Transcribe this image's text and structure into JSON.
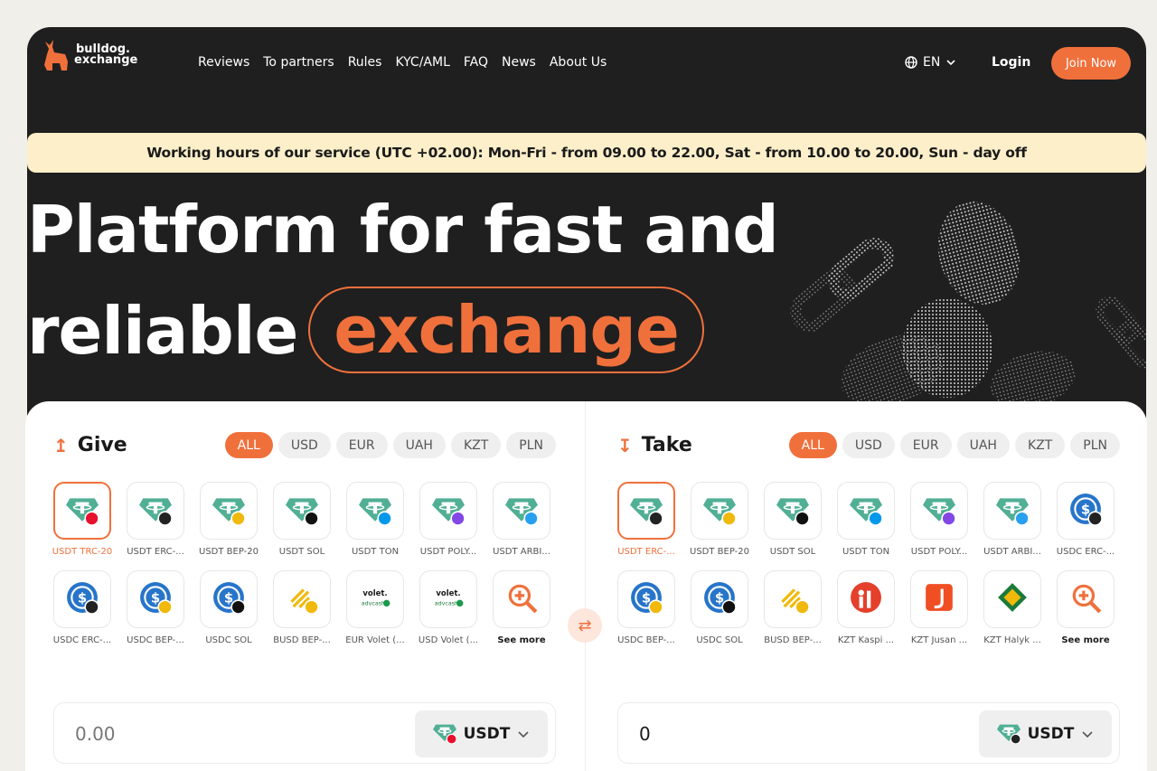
{
  "header": {
    "logo_line1": "bulldog.",
    "logo_line2": "exchange",
    "nav": [
      "Reviews",
      "To partners",
      "Rules",
      "KYC/AML",
      "FAQ",
      "News",
      "About Us"
    ],
    "language": "EN",
    "login": "Login",
    "join": "Join Now"
  },
  "banner": "Working hours of our service (UTC +02.00): Mon-Fri - from 09.00 to 22.00, Sat - from 10.00 to 20.00, Sun - day off",
  "hero": {
    "line1": "Platform for fast and",
    "line2": "reliable",
    "highlight": "exchange"
  },
  "give": {
    "title": "Give",
    "filters": [
      "ALL",
      "USD",
      "EUR",
      "UAH",
      "KZT",
      "PLN"
    ],
    "active_filter": "ALL",
    "coins": [
      {
        "label": "USDT TRC-20",
        "icon": "tether",
        "badge": "tron"
      },
      {
        "label": "USDT ERC-...",
        "icon": "tether",
        "badge": "eth"
      },
      {
        "label": "USDT BEP-20",
        "icon": "tether",
        "badge": "bnb"
      },
      {
        "label": "USDT SOL",
        "icon": "tether",
        "badge": "sol"
      },
      {
        "label": "USDT TON",
        "icon": "tether",
        "badge": "ton"
      },
      {
        "label": "USDT POLY...",
        "icon": "tether",
        "badge": "poly"
      },
      {
        "label": "USDT ARBI...",
        "icon": "tether",
        "badge": "arb"
      },
      {
        "label": "USDC ERC-...",
        "icon": "usdc",
        "badge": "eth"
      },
      {
        "label": "USDC BEP-...",
        "icon": "usdc",
        "badge": "bnb"
      },
      {
        "label": "USDC SOL",
        "icon": "usdc",
        "badge": "sol"
      },
      {
        "label": "BUSD BEP-...",
        "icon": "busd",
        "badge": "bnb"
      },
      {
        "label": "EUR Volet (...",
        "icon": "volet",
        "badge": ""
      },
      {
        "label": "USD Volet (...",
        "icon": "volet",
        "badge": ""
      },
      {
        "label": "See more",
        "icon": "search-plus",
        "badge": ""
      }
    ],
    "amount_placeholder": "0.00",
    "currency": "USDT"
  },
  "take": {
    "title": "Take",
    "filters": [
      "ALL",
      "USD",
      "EUR",
      "UAH",
      "KZT",
      "PLN"
    ],
    "active_filter": "ALL",
    "coins": [
      {
        "label": "USDT ERC-...",
        "icon": "tether",
        "badge": "eth"
      },
      {
        "label": "USDT BEP-20",
        "icon": "tether",
        "badge": "bnb"
      },
      {
        "label": "USDT SOL",
        "icon": "tether",
        "badge": "sol"
      },
      {
        "label": "USDT TON",
        "icon": "tether",
        "badge": "ton"
      },
      {
        "label": "USDT POLY...",
        "icon": "tether",
        "badge": "poly"
      },
      {
        "label": "USDT ARBI...",
        "icon": "tether",
        "badge": "arb"
      },
      {
        "label": "USDC ERC-...",
        "icon": "usdc",
        "badge": "eth"
      },
      {
        "label": "USDC BEP-...",
        "icon": "usdc",
        "badge": "bnb"
      },
      {
        "label": "USDC SOL",
        "icon": "usdc",
        "badge": "sol"
      },
      {
        "label": "BUSD BEP-...",
        "icon": "busd",
        "badge": "bnb"
      },
      {
        "label": "KZT Kaspi ...",
        "icon": "kaspi",
        "badge": ""
      },
      {
        "label": "KZT Jusan ...",
        "icon": "jusan",
        "badge": ""
      },
      {
        "label": "KZT Halyk ...",
        "icon": "halyk",
        "badge": ""
      },
      {
        "label": "See more",
        "icon": "search-plus",
        "badge": ""
      }
    ],
    "amount_value": "0",
    "currency": "USDT"
  },
  "colors": {
    "accent": "#f0703c",
    "dark": "#1f1f1f",
    "banner": "#fcefc9",
    "tether": "#50af95",
    "usdc": "#2775ca",
    "busd": "#f0b90b"
  }
}
